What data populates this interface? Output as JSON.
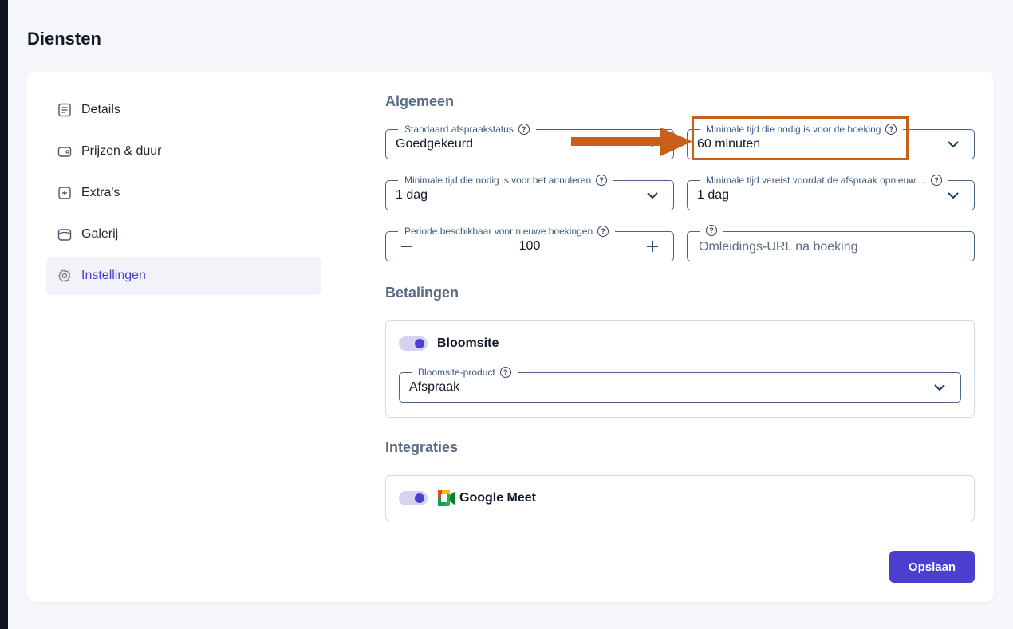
{
  "page": {
    "title": "Diensten"
  },
  "sidebar": {
    "items": [
      {
        "label": "Details",
        "icon": "document-icon",
        "active": false
      },
      {
        "label": "Prijzen & duur",
        "icon": "wallet-icon",
        "active": false
      },
      {
        "label": "Extra's",
        "icon": "plus-square-icon",
        "active": false
      },
      {
        "label": "Galerij",
        "icon": "gallery-icon",
        "active": false
      },
      {
        "label": "Instellingen",
        "icon": "gear-icon",
        "active": true
      }
    ]
  },
  "general": {
    "title": "Algemeen",
    "default_status": {
      "label": "Standaard afspraakstatus",
      "value": "Goedgekeurd"
    },
    "min_booking_time": {
      "label": "Minimale tijd die nodig is voor de boeking",
      "value": "60 minuten"
    },
    "min_cancel_time": {
      "label": "Minimale tijd die nodig is voor het annuleren",
      "value": "1 dag"
    },
    "min_reschedule_time": {
      "label": "Minimale tijd vereist voordat de afspraak opnieuw ...",
      "value": "1 dag"
    },
    "booking_period": {
      "label": "Periode beschikbaar voor nieuwe boekingen",
      "value": "100"
    },
    "redirect_url": {
      "label": "",
      "placeholder": "Omleidings-URL na boeking"
    }
  },
  "payments": {
    "title": "Betalingen",
    "provider": {
      "name": "Bloomsite",
      "enabled": true
    },
    "product": {
      "label": "Bloomsite-product",
      "value": "Afspraak"
    }
  },
  "integrations": {
    "title": "Integraties",
    "google_meet": {
      "name": "Google Meet",
      "enabled": true
    }
  },
  "actions": {
    "save_label": "Opslaan"
  },
  "colors": {
    "accent": "#4b3fcf",
    "annotation": "#c8601a",
    "section_title": "#5a6b85"
  }
}
